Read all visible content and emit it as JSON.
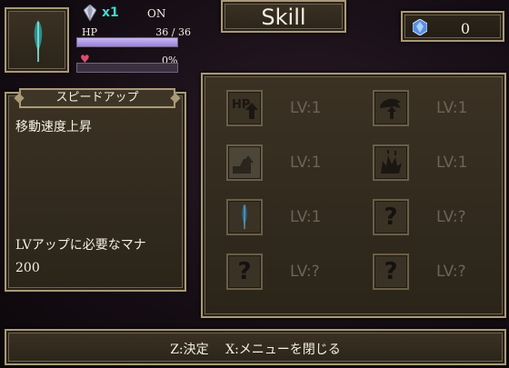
{
  "player": {
    "crystal_count": "x1",
    "status": "ON",
    "hp_label": "HP",
    "hp_value": "36 / 36",
    "hp_fraction": 1.0,
    "love_value": "0%",
    "love_fraction": 0.0
  },
  "title": "Skill",
  "mana": {
    "value": "0"
  },
  "description": {
    "header": "スピードアップ",
    "text": "移動速度上昇",
    "requirement_label": "LVアップに必要なマナ",
    "requirement_value": "200"
  },
  "skills": [
    {
      "icon": "hp-up-icon",
      "level": "LV:1"
    },
    {
      "icon": "stamina-up-icon",
      "level": "LV:1"
    },
    {
      "icon": "speed-up-icon",
      "level": "LV:1"
    },
    {
      "icon": "beast-icon",
      "level": "LV:1"
    },
    {
      "icon": "feather-icon",
      "level": "LV:1"
    },
    {
      "icon": "unknown-icon",
      "glyph": "?",
      "level": "LV:?"
    },
    {
      "icon": "unknown-icon",
      "glyph": "?",
      "level": "LV:?"
    },
    {
      "icon": "unknown-icon",
      "glyph": "?",
      "level": "LV:?"
    }
  ],
  "footer": {
    "text": "Z:決定　 X:メニューを閉じる"
  },
  "colors": {
    "accent_cyan": "#3fd9d0",
    "hp_bar": "#b39de8",
    "frame_border": "#a99a78"
  }
}
